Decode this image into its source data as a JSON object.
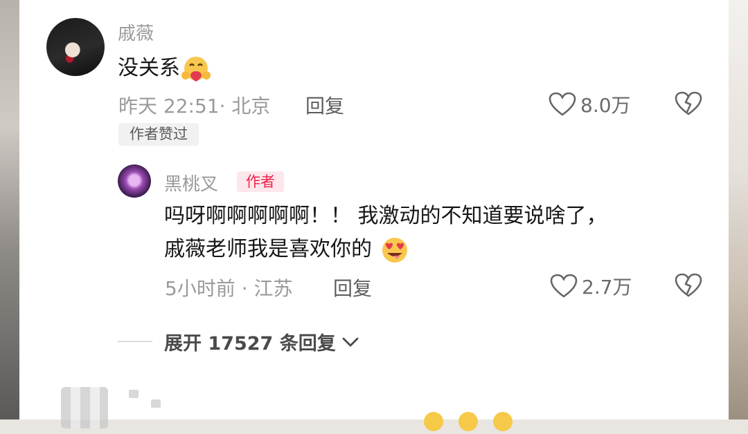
{
  "comments": [
    {
      "username": "戚薇",
      "text": "没关系",
      "emoji": "hugging-face-emoji",
      "time": "昨天 22:51",
      "location": "北京",
      "meta_sep": "· ",
      "reply_label": "回复",
      "likes": "8.0万",
      "badge": "作者赞过"
    },
    {
      "username": "黑桃叉",
      "author_badge": "作者",
      "text_line1": "吗呀啊啊啊啊啊！！ 我激动的不知道要说啥了，",
      "text_line2": "戚薇老师我是喜欢你的",
      "emoji": "heart-eyes-tongue-emoji",
      "time": "5小时前",
      "location": "江苏",
      "meta_sep": " · ",
      "reply_label": "回复",
      "likes": "2.7万"
    }
  ],
  "expand_replies": "展开 17527 条回复",
  "colors": {
    "accent": "#f0224b",
    "text": "#161616",
    "muted": "#9a9a9a"
  }
}
